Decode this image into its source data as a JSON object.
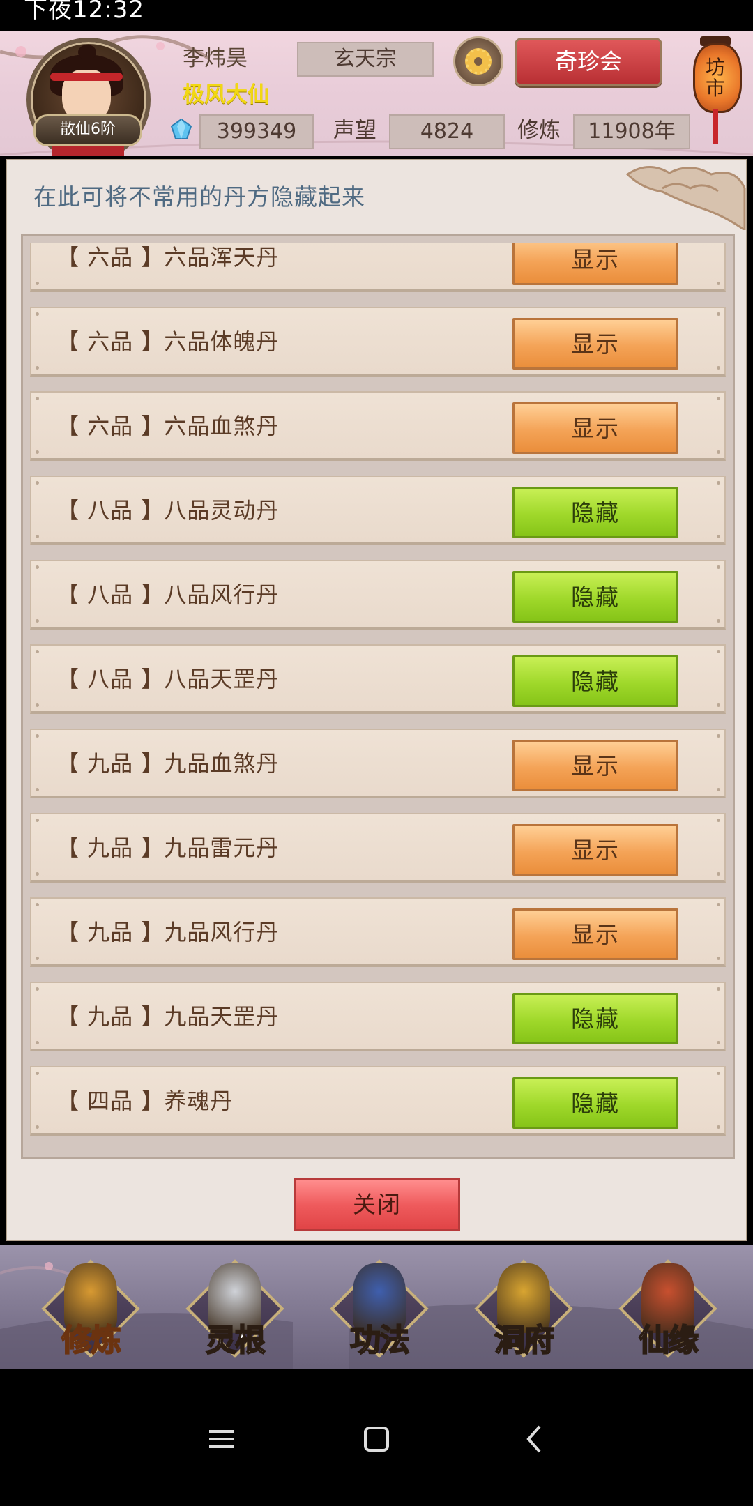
{
  "status_bar": {
    "time": "下夜12:32"
  },
  "header": {
    "player_name": "李炜昊",
    "player_title": "极风大仙",
    "rank": "散仙6阶",
    "sect": "玄天宗",
    "treasure_button": "奇珍会",
    "shop_lantern": "坊市",
    "gems": "399349",
    "prestige_label": "声望",
    "prestige": "4824",
    "cultivation_label": "修炼",
    "cultivation": "11908年"
  },
  "panel": {
    "description": "在此可将不常用的丹方隐藏起来",
    "rows": [
      {
        "name": "【 六品 】六品浑天丹",
        "button": "显示",
        "state": "show"
      },
      {
        "name": "【 六品 】六品体魄丹",
        "button": "显示",
        "state": "show"
      },
      {
        "name": "【 六品 】六品血煞丹",
        "button": "显示",
        "state": "show"
      },
      {
        "name": "【 八品 】八品灵动丹",
        "button": "隐藏",
        "state": "hide"
      },
      {
        "name": "【 八品 】八品风行丹",
        "button": "隐藏",
        "state": "hide"
      },
      {
        "name": "【 八品 】八品天罡丹",
        "button": "隐藏",
        "state": "hide"
      },
      {
        "name": "【 九品 】九品血煞丹",
        "button": "显示",
        "state": "show"
      },
      {
        "name": "【 九品 】九品雷元丹",
        "button": "显示",
        "state": "show"
      },
      {
        "name": "【 九品 】九品风行丹",
        "button": "显示",
        "state": "show"
      },
      {
        "name": "【 九品 】九品天罡丹",
        "button": "隐藏",
        "state": "hide"
      },
      {
        "name": "【 四品 】养魂丹",
        "button": "隐藏",
        "state": "hide"
      }
    ],
    "close_button": "关闭"
  },
  "bottom_nav": {
    "items": [
      {
        "label": "修炼",
        "icon": "meditating-monk-icon",
        "active": true
      },
      {
        "label": "灵根",
        "icon": "sword-yinyang-icon",
        "active": false
      },
      {
        "label": "功法",
        "icon": "scroll-book-icon",
        "active": false
      },
      {
        "label": "洞府",
        "icon": "pagoda-icon",
        "active": false
      },
      {
        "label": "仙缘",
        "icon": "gourd-icon",
        "active": false
      }
    ]
  },
  "android_nav": {
    "keys": [
      "menu-icon",
      "home-icon",
      "back-icon"
    ]
  },
  "colors": {
    "show_button": "#f4a357",
    "hide_button": "#9fd82a",
    "close_button": "#ef5b5d",
    "title_gold": "#f2d813",
    "description_blue": "#4f6a82"
  }
}
